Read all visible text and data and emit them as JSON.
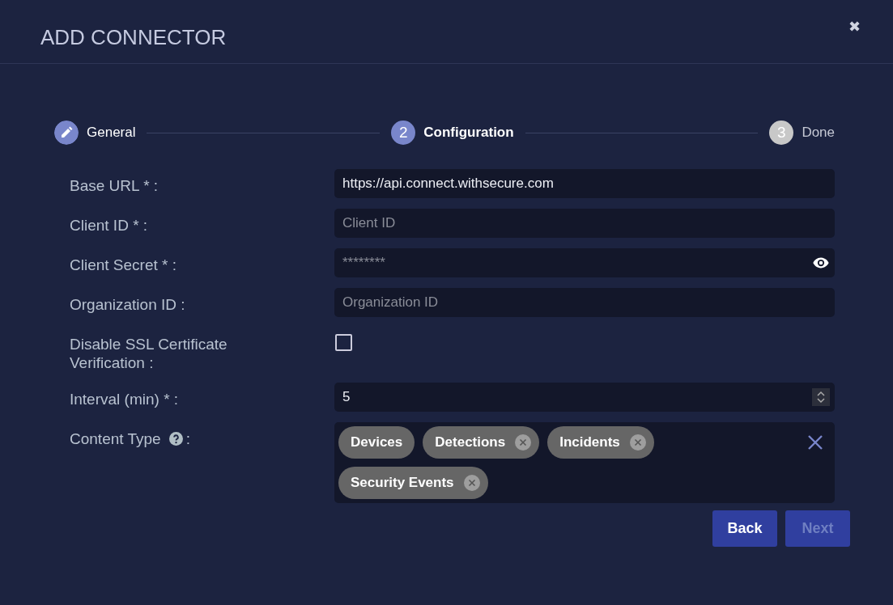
{
  "dialog": {
    "title": "ADD CONNECTOR",
    "close": "✖"
  },
  "steps": [
    {
      "label": "General",
      "completed": true,
      "selected": false
    },
    {
      "label": "Configuration",
      "number": "2",
      "completed": false,
      "selected": true
    },
    {
      "label": "Done",
      "number": "3",
      "completed": false,
      "selected": false
    }
  ],
  "fields": [
    {
      "kind": "text",
      "label": "Base URL * :",
      "value": "https://api.connect.withsecure.com"
    },
    {
      "kind": "text",
      "label": "Client ID * :",
      "placeholder": "Client ID"
    },
    {
      "kind": "password",
      "label": "Client Secret * :",
      "placeholder": "********"
    },
    {
      "kind": "text",
      "label": "Organization ID  :",
      "placeholder": "Organization ID"
    },
    {
      "kind": "checkbox",
      "label": "Disable SSL Certificate Verification  :",
      "checked": false
    },
    {
      "kind": "number",
      "label": "Interval (min) * :",
      "value": "5"
    },
    {
      "kind": "tags",
      "label": "Content Type",
      "help": true,
      "suffix": ":",
      "tags": [
        {
          "label": "Devices",
          "removable": false
        },
        {
          "label": "Detections",
          "removable": true
        },
        {
          "label": "Incidents",
          "removable": true
        },
        {
          "label": "Security Events",
          "removable": true
        }
      ]
    }
  ],
  "buttons": [
    {
      "label": "Back",
      "disabled": false
    },
    {
      "label": "Next",
      "disabled": true
    }
  ]
}
